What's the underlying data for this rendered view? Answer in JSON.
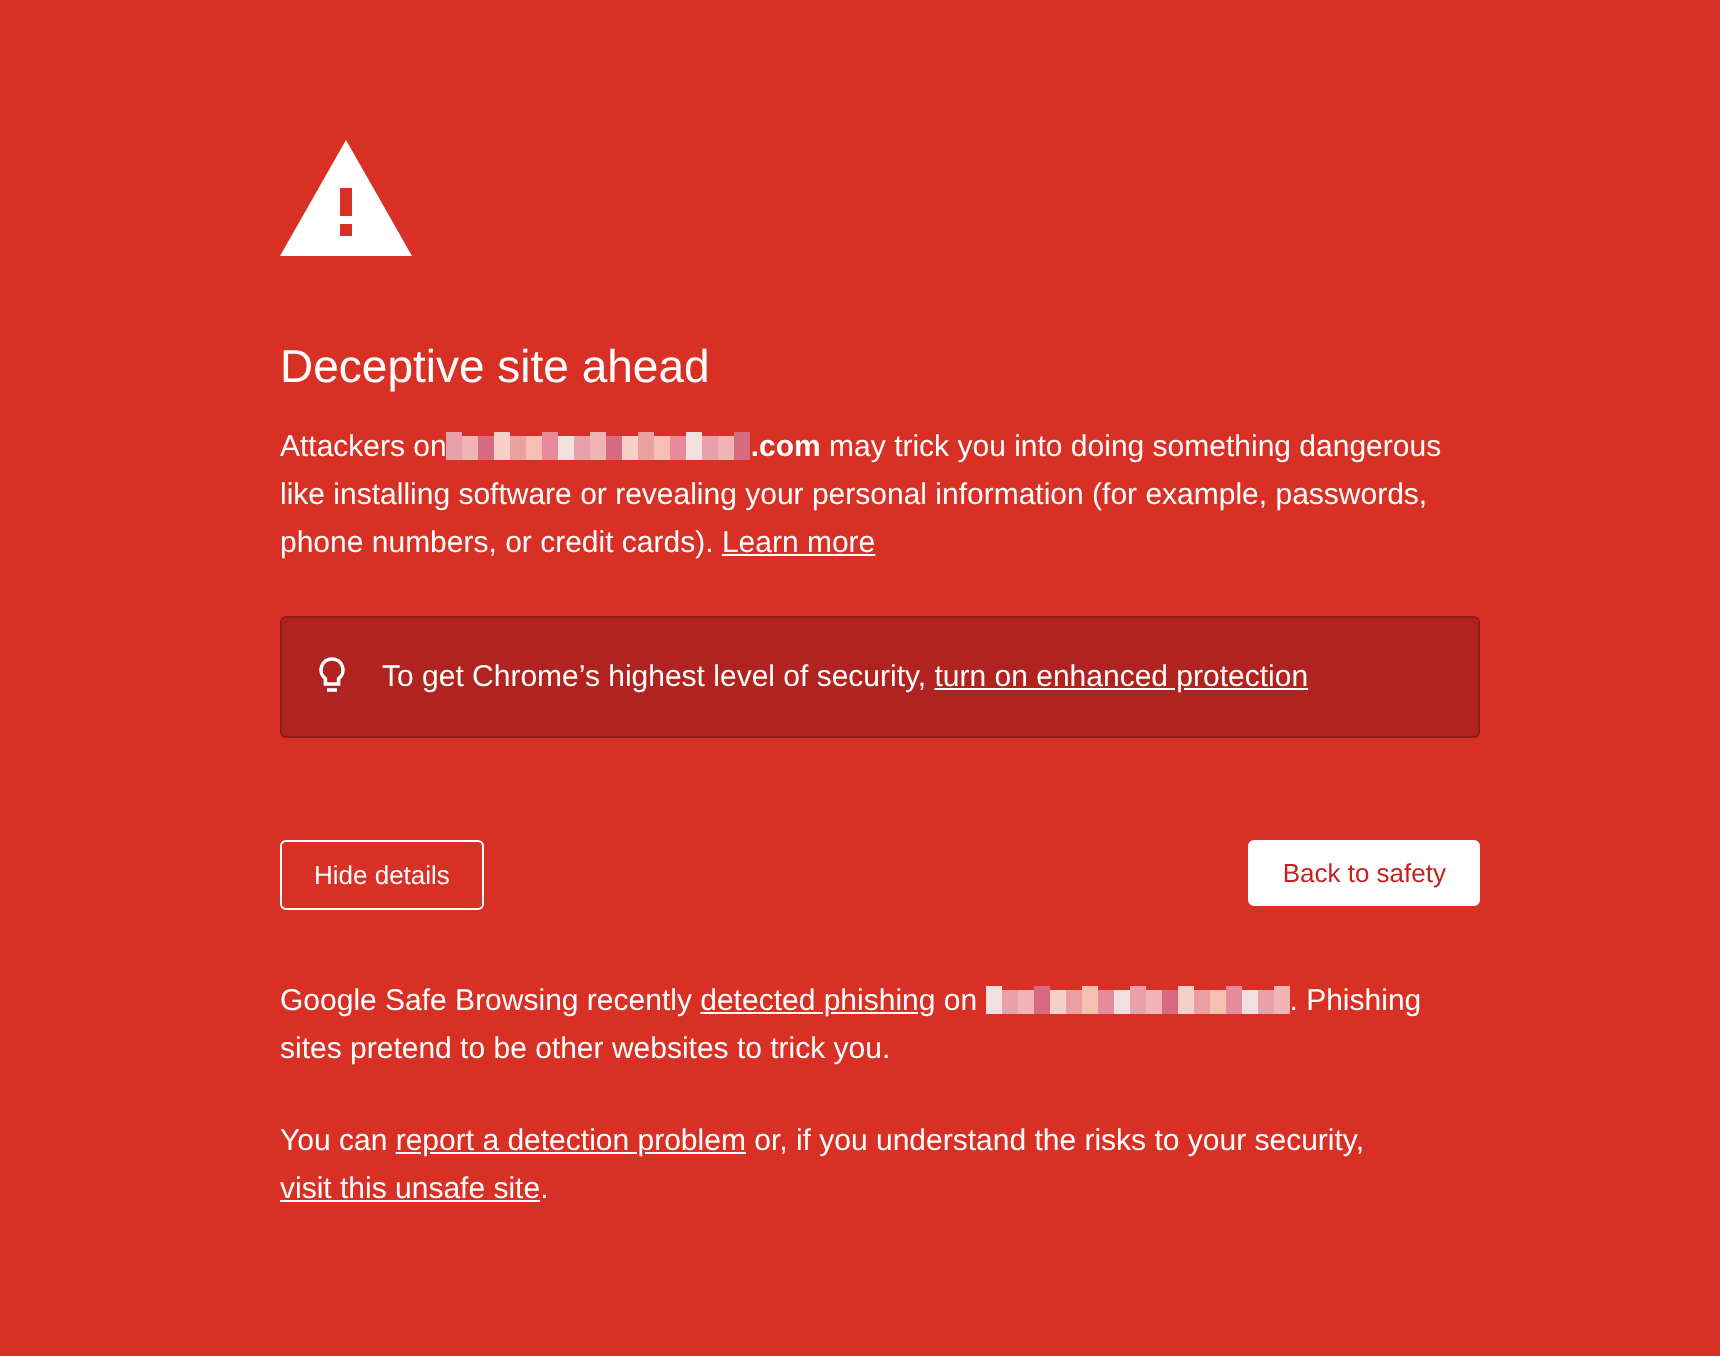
{
  "heading": "Deceptive site ahead",
  "intro": [
    {
      "kind": "text",
      "text": "Attackers on"
    },
    {
      "kind": "redacted"
    },
    {
      "kind": "bold",
      "text": ".com"
    },
    {
      "kind": "text",
      "text": " may trick you into doing something dangerous like installing software or revealing your personal information (for example, passwords, phone numbers, or credit cards). "
    },
    {
      "kind": "link",
      "text": "Learn more"
    }
  ],
  "notice": [
    {
      "kind": "text",
      "text": "To get Chrome’s highest level of security, "
    },
    {
      "kind": "link",
      "text": "turn on enhanced protection"
    }
  ],
  "buttons": {
    "details": "Hide details",
    "back": "Back to safety"
  },
  "details": [
    [
      {
        "kind": "text",
        "text": "Google Safe Browsing recently "
      },
      {
        "kind": "link",
        "text": "detected phishing"
      },
      {
        "kind": "text",
        "text": " on "
      },
      {
        "kind": "redacted"
      },
      {
        "kind": "text",
        "text": ". Phishing sites pretend to be other websites to trick you."
      }
    ],
    [
      {
        "kind": "text",
        "text": "You can "
      },
      {
        "kind": "link",
        "text": "report a detection problem"
      },
      {
        "kind": "text",
        "text": " or, if you understand the risks to your security, "
      },
      {
        "kind": "link",
        "text": "visit this unsafe site"
      },
      {
        "kind": "text",
        "text": "."
      }
    ]
  ]
}
